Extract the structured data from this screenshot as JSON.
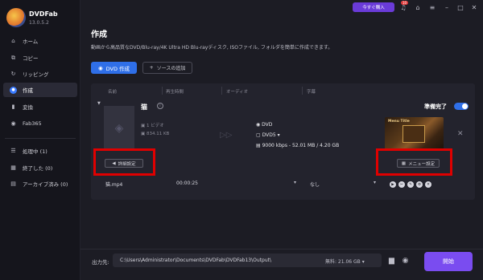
{
  "app": {
    "name": "DVDFab",
    "version": "13.0.5.2"
  },
  "topbar": {
    "buy_label": "今すぐ購入",
    "notif_count": "10"
  },
  "sidebar": {
    "items": [
      {
        "label": "ホーム",
        "icon": "home-icon"
      },
      {
        "label": "コピー",
        "icon": "copy-icon"
      },
      {
        "label": "リッピング",
        "icon": "ripper-icon"
      },
      {
        "label": "作成",
        "icon": "creator-icon"
      },
      {
        "label": "変換",
        "icon": "convert-icon"
      },
      {
        "label": "Fab365",
        "icon": "fab365-icon"
      }
    ],
    "queue": [
      {
        "label": "処理中 (1)"
      },
      {
        "label": "終了した (0)"
      },
      {
        "label": "アーカイブ済み (0)"
      }
    ]
  },
  "main": {
    "title": "作成",
    "subtitle": "動画から高品質なDVD/Blu-ray/4K Ultra HD Blu-rayディスク, ISOファイル, フォルダを簡単に作成できます。",
    "create_button": "DVD 作成",
    "add_source_button": "ソースの追加"
  },
  "table": {
    "headers": [
      "名前",
      "再生時間",
      "オーディオ",
      "字幕"
    ],
    "item": {
      "name": "猫",
      "source_type": "1 ビデオ",
      "size": "834.11 KB",
      "output_format": "DVD",
      "disc": "DVD5",
      "bitrate": "9000 kbps - 52.01 MB / 4.20 GB",
      "status": "準備完了",
      "menu_title": "Menu Title",
      "advanced_button": "詳細設定",
      "menu_button": "メニュー設定",
      "file": "猫.mp4",
      "duration": "00:00:25",
      "subtitle": "なし"
    }
  },
  "bottom": {
    "output_label": "出力先:",
    "output_path": "C:\\Users\\Administrator\\Documents\\DVDFab\\DVDFab13\\Output\\",
    "free_space": "無料: 21.06 GB",
    "start_button": "開始"
  },
  "colors": {
    "accent": "#2f6fe8",
    "start": "#7a4cf0",
    "highlight": "#e00000"
  }
}
